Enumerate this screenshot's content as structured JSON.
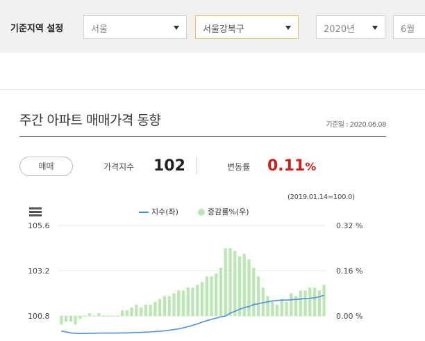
{
  "filters": {
    "label": "기준지역 설정",
    "region": "서울",
    "district": "서울강북구",
    "year": "2020년",
    "month": "6월"
  },
  "section": {
    "title": "주간 아파트 매매가격 동향",
    "base_date": "기준일 : 2020.06.08"
  },
  "toggle_label": "매매",
  "stats": {
    "index_label": "가격지수",
    "index_value": "102",
    "change_label": "변동률",
    "change_value": "0.11",
    "change_unit": "%"
  },
  "chart_note": "(2019.01.14=100.0)",
  "legend": {
    "line_label": "지수(좌)",
    "bar_label": "증감률%(우)"
  },
  "colors": {
    "accent_red": "#d0201a",
    "line": "#4a90e2",
    "bar": "#b8e8b0",
    "active_border": "#e6c65c"
  },
  "chart_data": {
    "type": "bar+line",
    "left_axis": {
      "ticks": [
        "105.6",
        "103.2",
        "100.8"
      ],
      "range": [
        100.8,
        105.6
      ]
    },
    "right_axis": {
      "ticks": [
        "0.32 %",
        "0.16 %",
        "0.00 %"
      ],
      "range": [
        0.0,
        0.32
      ]
    },
    "series": [
      {
        "name": "증감률%(우)",
        "axis": "right",
        "kind": "bar",
        "values": [
          -0.03,
          -0.02,
          -0.02,
          -0.03,
          -0.01,
          0.0,
          0.01,
          0.0,
          0.01,
          0.0,
          0.0,
          0.0,
          0.0,
          0.02,
          0.02,
          0.03,
          0.04,
          0.03,
          0.04,
          0.04,
          0.05,
          0.06,
          0.07,
          0.07,
          0.08,
          0.09,
          0.09,
          0.1,
          0.1,
          0.11,
          0.12,
          0.14,
          0.14,
          0.15,
          0.17,
          0.24,
          0.24,
          0.23,
          0.21,
          0.22,
          0.2,
          0.17,
          0.14,
          0.1,
          0.07,
          0.05,
          0.04,
          0.06,
          0.05,
          0.08,
          0.07,
          0.09,
          0.09,
          0.1,
          0.1,
          0.09,
          0.11
        ]
      },
      {
        "name": "지수(좌)",
        "axis": "left",
        "kind": "line",
        "values": [
          100.0,
          99.95,
          99.9,
          99.88,
          99.87,
          99.87,
          99.88,
          99.88,
          99.89,
          99.89,
          99.89,
          99.89,
          99.89,
          99.9,
          99.9,
          99.91,
          99.92,
          99.93,
          99.94,
          99.95,
          99.97,
          99.99,
          100.01,
          100.04,
          100.08,
          100.12,
          100.17,
          100.23,
          100.3,
          100.38,
          100.47,
          100.55,
          100.62,
          100.69,
          100.75,
          100.8,
          100.95,
          101.05,
          101.15,
          101.25,
          101.3,
          101.4,
          101.45,
          101.5,
          101.55,
          101.6,
          101.62,
          101.64,
          101.64,
          101.66,
          101.68,
          101.7,
          101.72,
          101.74,
          101.76,
          101.82,
          101.9
        ]
      }
    ],
    "grid": true,
    "legend_position": "top"
  }
}
